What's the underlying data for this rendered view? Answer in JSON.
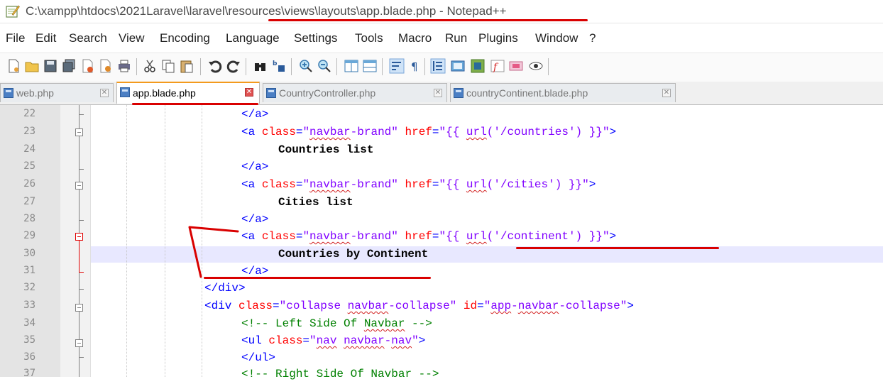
{
  "window": {
    "title": "C:\\xampp\\htdocs\\2021Laravel\\laravel\\resources\\views\\layouts\\app.blade.php - Notepad++"
  },
  "menu": [
    "File",
    "Edit",
    "Search",
    "View",
    "Encoding",
    "Language",
    "Settings",
    "Tools",
    "Macro",
    "Run",
    "Plugins",
    "Window",
    "?"
  ],
  "toolbar": {
    "icons": [
      "new-file-icon",
      "open-file-icon",
      "save-icon",
      "save-all-icon",
      "close-icon",
      "close-all-icon",
      "print-icon",
      "cut-icon",
      "copy-icon",
      "paste-icon",
      "undo-icon",
      "redo-icon",
      "find-icon",
      "replace-icon",
      "zoom-in-icon",
      "zoom-out-icon",
      "sync-vertical-icon",
      "sync-horizontal-icon",
      "word-wrap-icon",
      "show-all-chars-icon",
      "indent-guide-icon",
      "doc-map-icon",
      "function-list-icon",
      "folder-workspace-icon",
      "monitor-icon"
    ]
  },
  "tabs": [
    {
      "label": "web.php",
      "active": false
    },
    {
      "label": "app.blade.php",
      "active": true
    },
    {
      "label": "CountryController.php",
      "active": false
    },
    {
      "label": "countryContinent.blade.php",
      "active": false
    }
  ],
  "editor": {
    "highlight_line": 30,
    "lines": [
      {
        "num": "22",
        "text": "</a>"
      },
      {
        "num": "23",
        "text": "<a class=\"navbar-brand\" href=\"{{ url('/countries') }}\">"
      },
      {
        "num": "24",
        "text": "Countries list"
      },
      {
        "num": "25",
        "text": "</a>"
      },
      {
        "num": "26",
        "text": "<a class=\"navbar-brand\" href=\"{{ url('/cities') }}\">"
      },
      {
        "num": "27",
        "text": "Cities list"
      },
      {
        "num": "28",
        "text": "</a>"
      },
      {
        "num": "29",
        "text": "<a class=\"navbar-brand\" href=\"{{ url('/continent') }}\">"
      },
      {
        "num": "30",
        "text": "Countries by Continent"
      },
      {
        "num": "31",
        "text": "</a>"
      },
      {
        "num": "32",
        "text": "</div>"
      },
      {
        "num": "33",
        "text": "<div class=\"collapse navbar-collapse\" id=\"app-navbar-collapse\">"
      },
      {
        "num": "34",
        "text": "<!-- Left Side Of Navbar -->"
      },
      {
        "num": "35",
        "text": "<ul class=\"nav navbar-nav\">"
      },
      {
        "num": "36",
        "text": "</ul>"
      },
      {
        "num": "37",
        "text": "<!-- Right Side Of Navbar -->"
      }
    ]
  },
  "colors": {
    "tag": "#0000ff",
    "attribute": "#ff0000",
    "string": "#8000ff",
    "comment": "#008000",
    "active_tab_accent": "#f39a1d",
    "annotation": "#d90000"
  }
}
